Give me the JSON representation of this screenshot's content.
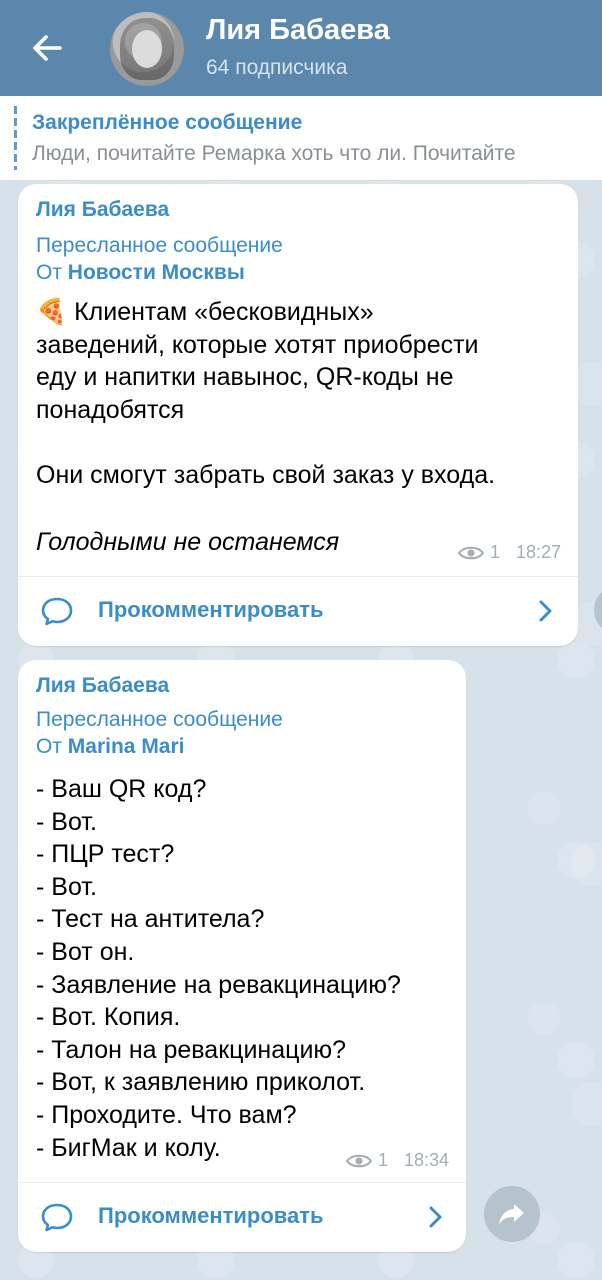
{
  "header": {
    "channel_name": "Лия Бабаева",
    "subscribers": "64 подписчика"
  },
  "pinned": {
    "title": "Закреплённое сообщение",
    "text": "Люди, почитайте Ремарка хоть что ли.  Почитайте"
  },
  "messages": [
    {
      "sender": "Лия Бабаева",
      "forwarded_label": "Пересланное сообщение",
      "forwarded_prefix": "От ",
      "forwarded_source": "Новости Москвы",
      "emoji": "🍕",
      "text_main": " Клиентам «бесковидных»\nзаведений, которые хотят приобрести\nеду и напитки навынос, QR-коды не\nпонадобятся\n\nОни смогут забрать свой заказ у входа.",
      "text_italic": "Голодными не останемся",
      "views": "1",
      "time": "18:27",
      "comment_label": "Прокомментировать"
    },
    {
      "sender": "Лия Бабаева",
      "forwarded_label": "Пересланное сообщение",
      "forwarded_prefix": "От ",
      "forwarded_source": "Marina Mari",
      "text_main": "- Ваш QR код?\n- Вот.\n- ПЦР тест?\n- Вот.\n- Тест на антитела?\n- Вот он.\n- Заявление на ревакцинацию?\n- Вот. Копия.\n- Талон на ревакцинацию?\n- Вот, к заявлению приколот.\n- Проходите. Что вам?\n- БигМак и колу.",
      "views": "1",
      "time": "18:34",
      "comment_label": "Прокомментировать"
    }
  ],
  "icons": {
    "back": "back-arrow-icon",
    "eye": "eye-icon",
    "comment": "comment-bubble-icon",
    "chevron": "chevron-right-icon",
    "share": "share-icon"
  },
  "colors": {
    "header_bg": "#5b87ad",
    "accent": "#3a8dc9",
    "meta": "#a4aeb6",
    "chat_bg": "#d6e1ea"
  }
}
